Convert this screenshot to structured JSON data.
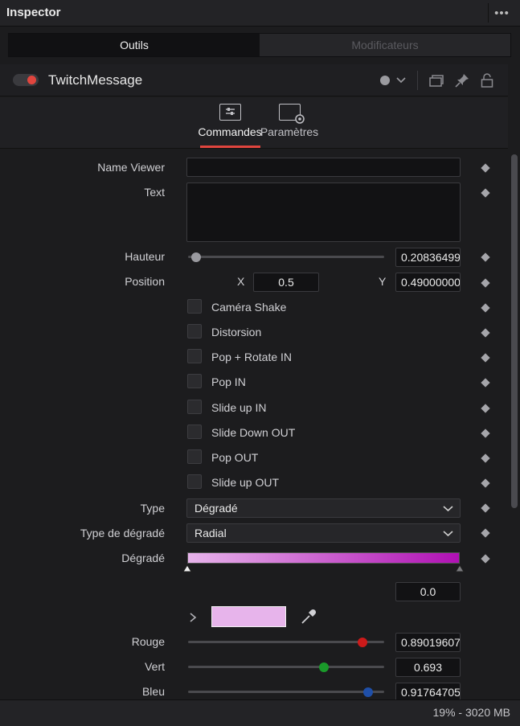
{
  "panel": {
    "title": "Inspector",
    "menu_icon": "more-dots-icon"
  },
  "tabs": [
    {
      "label": "Outils",
      "active": true
    },
    {
      "label": "Modificateurs",
      "active": false
    }
  ],
  "node": {
    "name": "TwitchMessage",
    "enabled": true,
    "toggle_color": "#e0453e"
  },
  "subtabs": [
    {
      "label": "Commandes",
      "icon": "sliders-icon",
      "active": true
    },
    {
      "label": "Paramètres",
      "icon": "settings-gear-icon",
      "active": false
    }
  ],
  "controls": {
    "name_viewer": {
      "label": "Name Viewer",
      "value": ""
    },
    "text": {
      "label": "Text",
      "value": ""
    },
    "hauteur": {
      "label": "Hauteur",
      "value": "0.20836499",
      "slider_fraction": 0.04
    },
    "position": {
      "label": "Position",
      "x_label": "X",
      "x_value": "0.5",
      "y_label": "Y",
      "y_value": "0.49000000"
    },
    "checkboxes": [
      {
        "label": "Caméra Shake",
        "checked": false
      },
      {
        "label": "Distorsion",
        "checked": false
      },
      {
        "label": "Pop + Rotate IN",
        "checked": false
      },
      {
        "label": "Pop IN",
        "checked": false
      },
      {
        "label": "Slide up IN",
        "checked": false
      },
      {
        "label": "Slide Down OUT",
        "checked": false
      },
      {
        "label": "Pop OUT",
        "checked": false
      },
      {
        "label": "Slide up OUT",
        "checked": false
      }
    ],
    "type": {
      "label": "Type",
      "value": "Dégradé"
    },
    "type_degrade": {
      "label": "Type de dégradé",
      "value": "Radial"
    },
    "degrade": {
      "label": "Dégradé",
      "start_color": "#e7b4eb",
      "end_color": "#b010b4",
      "stop_value": "0.0"
    },
    "color_swatch": "#e7b4eb",
    "rouge": {
      "label": "Rouge",
      "value": "0.89019607",
      "fraction": 0.89,
      "knob_color": "#cc1a1a"
    },
    "vert": {
      "label": "Vert",
      "value": "0.693",
      "fraction": 0.693,
      "knob_color": "#1a9a2a"
    },
    "bleu": {
      "label": "Bleu",
      "value": "0.91764705",
      "fraction": 0.918,
      "knob_color": "#1f4fa8"
    }
  },
  "status": {
    "text": "19% - 3020 MB"
  }
}
